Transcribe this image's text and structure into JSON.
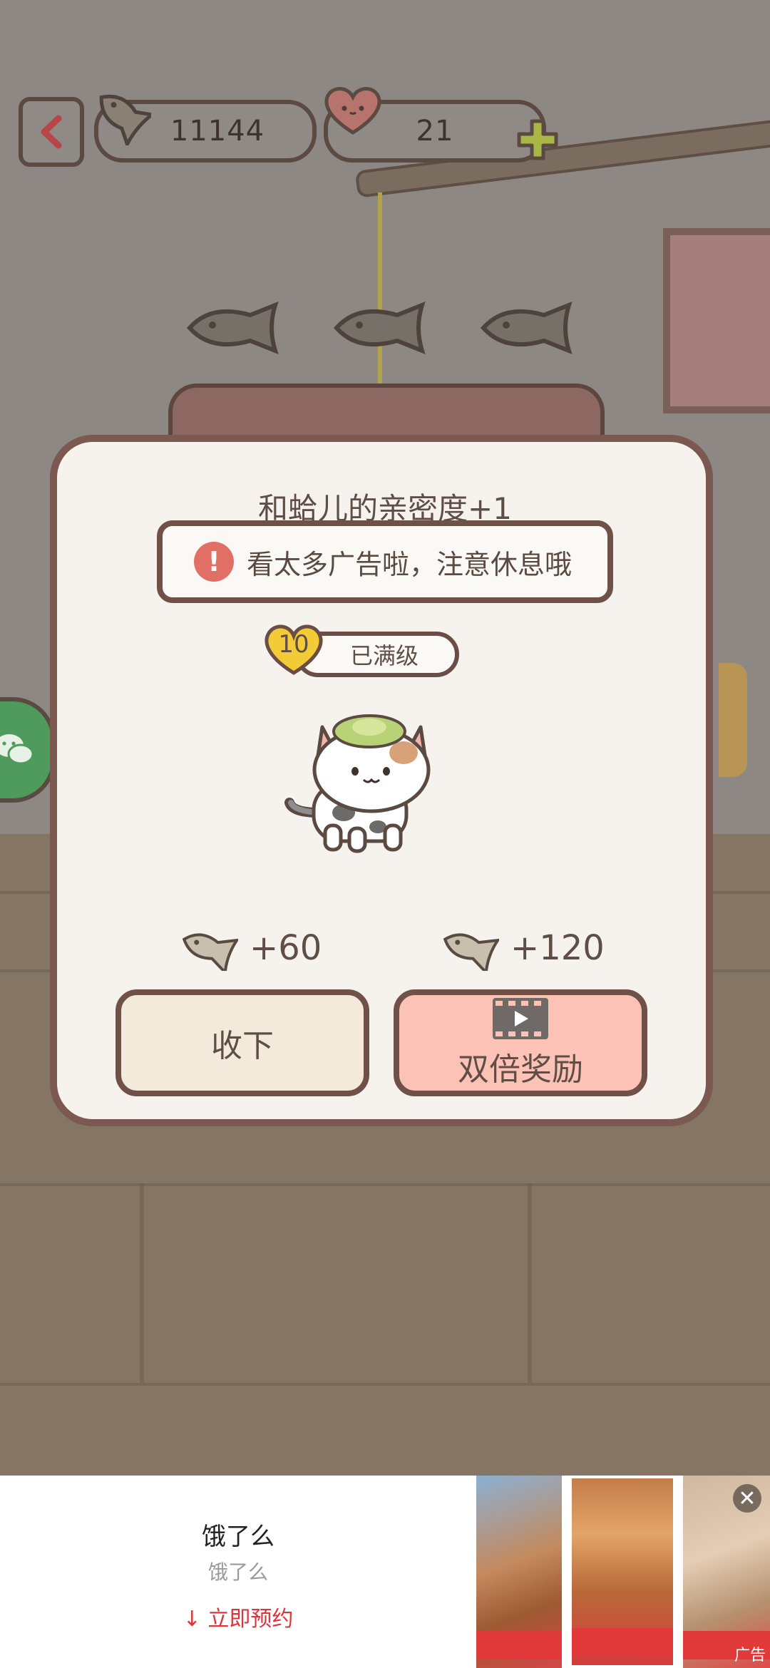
{
  "topbar": {
    "fish_count": "11144",
    "heart_count": "21"
  },
  "dialog": {
    "title": "和蛤儿的亲密度+1",
    "warning": "看太多广告啦，注意休息哦",
    "warning_icon": "!",
    "level_number": "10",
    "level_status": "已满级",
    "reward_normal": "+60",
    "reward_double": "+120",
    "accept_label": "收下",
    "double_label": "双倍奖励"
  },
  "ad": {
    "title": "饿了么",
    "subtitle": "饿了么",
    "cta": "立即预约",
    "close": "✕",
    "label": "广告"
  },
  "colors": {
    "dialog_bg": "#f6f3ee",
    "border": "#7b5850",
    "accept_bg": "#f3eadb",
    "double_bg": "#fdc2b6",
    "warning_red": "#e26f66",
    "ad_cta": "#e0343c"
  }
}
